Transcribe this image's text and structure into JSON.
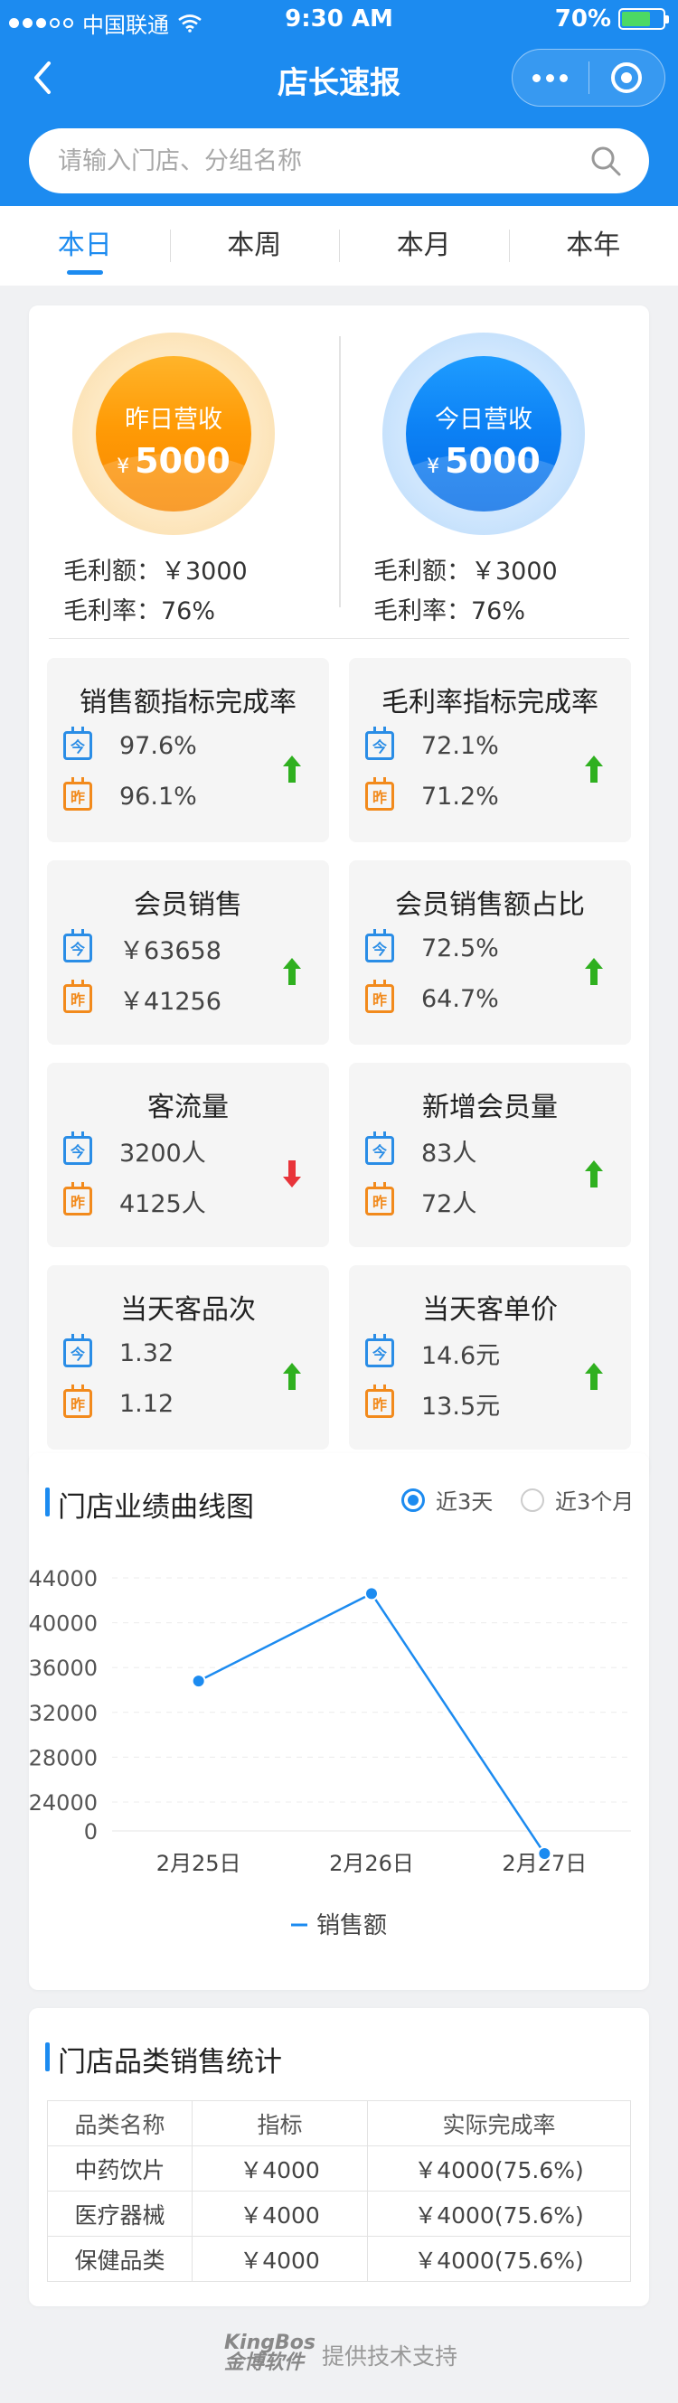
{
  "status_bar": {
    "carrier": "中国联通",
    "time": "9:30 AM",
    "battery": "70%"
  },
  "nav": {
    "title": "店长速报"
  },
  "search": {
    "placeholder": "请输入门店、分组名称"
  },
  "tabs": [
    {
      "label": "本日",
      "active": true
    },
    {
      "label": "本周",
      "active": false
    },
    {
      "label": "本月",
      "active": false
    },
    {
      "label": "本年",
      "active": false
    }
  ],
  "summary": {
    "yesterday": {
      "label": "昨日营收",
      "currency": "¥",
      "value": "5000",
      "gross_profit": "毛利额：￥3000",
      "gross_margin": "毛利率：76%"
    },
    "today": {
      "label": "今日营收",
      "currency": "¥",
      "value": "5000",
      "gross_profit": "毛利额：￥3000",
      "gross_margin": "毛利率：76%"
    }
  },
  "calendar_icons": {
    "today": "今",
    "yesterday": "昨"
  },
  "kpis": [
    {
      "title": "销售额指标完成率",
      "today": "97.6%",
      "yesterday": "96.1%",
      "trend": "up"
    },
    {
      "title": "毛利率指标完成率",
      "today": "72.1%",
      "yesterday": "71.2%",
      "trend": "up"
    },
    {
      "title": "会员销售",
      "today": "￥63658",
      "yesterday": "￥41256",
      "trend": "up"
    },
    {
      "title": "会员销售额占比",
      "today": "72.5%",
      "yesterday": "64.7%",
      "trend": "up"
    },
    {
      "title": "客流量",
      "today": "3200人",
      "yesterday": "4125人",
      "trend": "down"
    },
    {
      "title": "新增会员量",
      "today": "83人",
      "yesterday": "72人",
      "trend": "up"
    },
    {
      "title": "当天客品次",
      "today": "1.32",
      "yesterday": "1.12",
      "trend": "up"
    },
    {
      "title": "当天客单价",
      "today": "14.6元",
      "yesterday": "13.5元",
      "trend": "up"
    }
  ],
  "trend_colors": {
    "up": "#2fb01f",
    "down": "#e8343a"
  },
  "performance": {
    "title": "门店业绩曲线图",
    "options": [
      {
        "label": "近3天",
        "selected": true
      },
      {
        "label": "近3个月",
        "selected": false
      }
    ]
  },
  "chart_data": {
    "type": "line",
    "categories": [
      "2月25日",
      "2月26日",
      "2月27日"
    ],
    "series": [
      {
        "name": "销售额",
        "values": [
          34800,
          42600,
          19400
        ],
        "color": "#1c8bf0"
      }
    ],
    "ylim": [
      0,
      44000
    ],
    "y_ticks": [
      0,
      24000,
      28000,
      32000,
      36000,
      40000,
      44000
    ],
    "y_break": true,
    "grid": true,
    "legend": "bottom"
  },
  "category_stats": {
    "title": "门店品类销售统计",
    "columns": [
      "品类名称",
      "指标",
      "实际完成率"
    ],
    "rows": [
      [
        "中药饮片",
        "￥4000",
        "￥4000(75.6%)"
      ],
      [
        "医疗器械",
        "￥4000",
        "￥4000(75.6%)"
      ],
      [
        "保健品类",
        "￥4000",
        "￥4000(75.6%)"
      ]
    ]
  },
  "footer": {
    "logo_line1": "KingBos",
    "logo_line2": "金博软件",
    "text": "提供技术支持"
  }
}
